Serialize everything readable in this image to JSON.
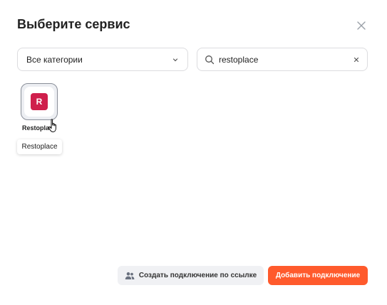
{
  "dialog": {
    "title": "Выберите сервис",
    "close_icon": "close-icon"
  },
  "filters": {
    "category": {
      "selected": "Все категории",
      "icon": "chevron-down-icon"
    },
    "search": {
      "value": "restoplace",
      "icon": "search-icon",
      "clear_icon": "clear-icon"
    }
  },
  "services": [
    {
      "name": "Restoplace",
      "logo_letter": "R",
      "logo_color": "#cf1f4c",
      "tooltip": "Restoplace"
    }
  ],
  "footer": {
    "link_button_label": "Создать подключение по ссылке",
    "link_button_icon": "users-icon",
    "add_button_label": "Добавить подключение",
    "accent_color": "#ff5a2c"
  }
}
